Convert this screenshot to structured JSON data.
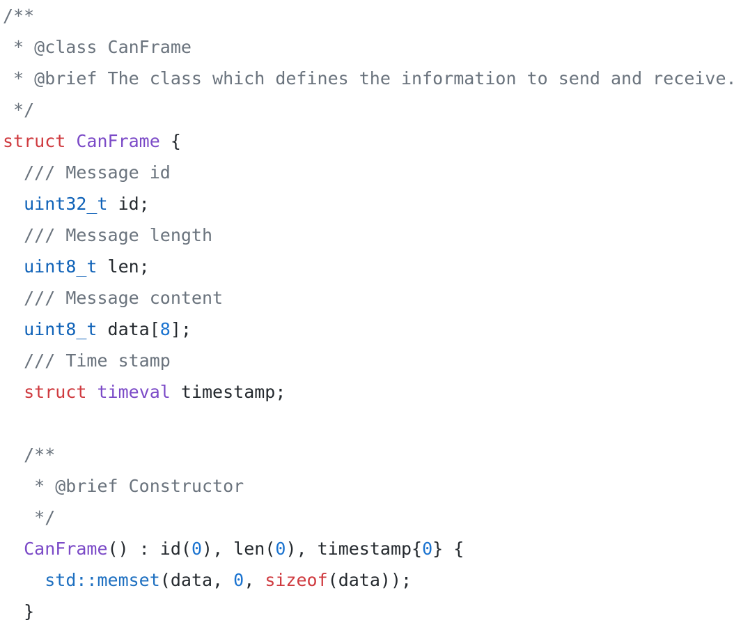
{
  "editor": {
    "language": "C++",
    "background": "#ffffff",
    "font_size_px": 25,
    "line_height_px": 45,
    "palette": {
      "comment": "#6a737d",
      "keyword": "#cf3a3f",
      "type": "#7b4ac7",
      "builtin_type": "#0f62b8",
      "function": "#1d6fc0",
      "number": "#1a73d0",
      "plain": "#24292e"
    }
  },
  "code": {
    "lines": [
      {
        "id": "line-1",
        "text": "/**",
        "tokens": [
          {
            "t": "/**",
            "k": "comment"
          }
        ]
      },
      {
        "id": "line-2",
        "text": " * @class CanFrame",
        "tokens": [
          {
            "t": " * @class CanFrame",
            "k": "comment"
          }
        ]
      },
      {
        "id": "line-3",
        "text": " * @brief The class which defines the information to send and receive.",
        "tokens": [
          {
            "t": " * @brief The class which defines the information to send and receive.",
            "k": "comment"
          }
        ]
      },
      {
        "id": "line-4",
        "text": " */",
        "tokens": [
          {
            "t": " */",
            "k": "comment"
          }
        ]
      },
      {
        "id": "line-5",
        "text": "struct CanFrame {",
        "tokens": [
          {
            "t": "struct",
            "k": "keyword"
          },
          {
            "t": " ",
            "k": "plain"
          },
          {
            "t": "CanFrame",
            "k": "type"
          },
          {
            "t": " {",
            "k": "plain"
          }
        ]
      },
      {
        "id": "line-6",
        "text": "  /// Message id",
        "tokens": [
          {
            "t": "  ",
            "k": "plain"
          },
          {
            "t": "/// Message id",
            "k": "comment"
          }
        ]
      },
      {
        "id": "line-7",
        "text": "  uint32_t id;",
        "tokens": [
          {
            "t": "  ",
            "k": "plain"
          },
          {
            "t": "uint32_t",
            "k": "builtin_type"
          },
          {
            "t": " id;",
            "k": "plain"
          }
        ]
      },
      {
        "id": "line-8",
        "text": "  /// Message length",
        "tokens": [
          {
            "t": "  ",
            "k": "plain"
          },
          {
            "t": "/// Message length",
            "k": "comment"
          }
        ]
      },
      {
        "id": "line-9",
        "text": "  uint8_t len;",
        "tokens": [
          {
            "t": "  ",
            "k": "plain"
          },
          {
            "t": "uint8_t",
            "k": "builtin_type"
          },
          {
            "t": " len;",
            "k": "plain"
          }
        ]
      },
      {
        "id": "line-10",
        "text": "  /// Message content",
        "tokens": [
          {
            "t": "  ",
            "k": "plain"
          },
          {
            "t": "/// Message content",
            "k": "comment"
          }
        ]
      },
      {
        "id": "line-11",
        "text": "  uint8_t data[8];",
        "tokens": [
          {
            "t": "  ",
            "k": "plain"
          },
          {
            "t": "uint8_t",
            "k": "builtin_type"
          },
          {
            "t": " data[",
            "k": "plain"
          },
          {
            "t": "8",
            "k": "number"
          },
          {
            "t": "];",
            "k": "plain"
          }
        ]
      },
      {
        "id": "line-12",
        "text": "  /// Time stamp",
        "tokens": [
          {
            "t": "  ",
            "k": "plain"
          },
          {
            "t": "/// Time stamp",
            "k": "comment"
          }
        ]
      },
      {
        "id": "line-13",
        "text": "  struct timeval timestamp;",
        "tokens": [
          {
            "t": "  ",
            "k": "plain"
          },
          {
            "t": "struct",
            "k": "keyword"
          },
          {
            "t": " ",
            "k": "plain"
          },
          {
            "t": "timeval",
            "k": "type"
          },
          {
            "t": " timestamp;",
            "k": "plain"
          }
        ]
      },
      {
        "id": "line-14",
        "text": "",
        "tokens": []
      },
      {
        "id": "line-15",
        "text": "  /**",
        "tokens": [
          {
            "t": "  ",
            "k": "plain"
          },
          {
            "t": "/**",
            "k": "comment"
          }
        ]
      },
      {
        "id": "line-16",
        "text": "   * @brief Constructor",
        "tokens": [
          {
            "t": "   ",
            "k": "plain"
          },
          {
            "t": "* @brief Constructor",
            "k": "comment"
          }
        ]
      },
      {
        "id": "line-17",
        "text": "   */",
        "tokens": [
          {
            "t": "   ",
            "k": "plain"
          },
          {
            "t": "*/",
            "k": "comment"
          }
        ]
      },
      {
        "id": "line-18",
        "text": "  CanFrame() : id(0), len(0), timestamp{0} {",
        "tokens": [
          {
            "t": "  ",
            "k": "plain"
          },
          {
            "t": "CanFrame",
            "k": "type"
          },
          {
            "t": "() : id(",
            "k": "plain"
          },
          {
            "t": "0",
            "k": "number"
          },
          {
            "t": "), len(",
            "k": "plain"
          },
          {
            "t": "0",
            "k": "number"
          },
          {
            "t": "), timestamp{",
            "k": "plain"
          },
          {
            "t": "0",
            "k": "number"
          },
          {
            "t": "} {",
            "k": "plain"
          }
        ]
      },
      {
        "id": "line-19",
        "text": "    std::memset(data, 0, sizeof(data));",
        "tokens": [
          {
            "t": "    ",
            "k": "plain"
          },
          {
            "t": "std::memset",
            "k": "function"
          },
          {
            "t": "(data, ",
            "k": "plain"
          },
          {
            "t": "0",
            "k": "number"
          },
          {
            "t": ", ",
            "k": "plain"
          },
          {
            "t": "sizeof",
            "k": "keyword"
          },
          {
            "t": "(data));",
            "k": "plain"
          }
        ]
      },
      {
        "id": "line-20",
        "text": "  }",
        "tokens": [
          {
            "t": "  }",
            "k": "plain"
          }
        ]
      }
    ]
  }
}
